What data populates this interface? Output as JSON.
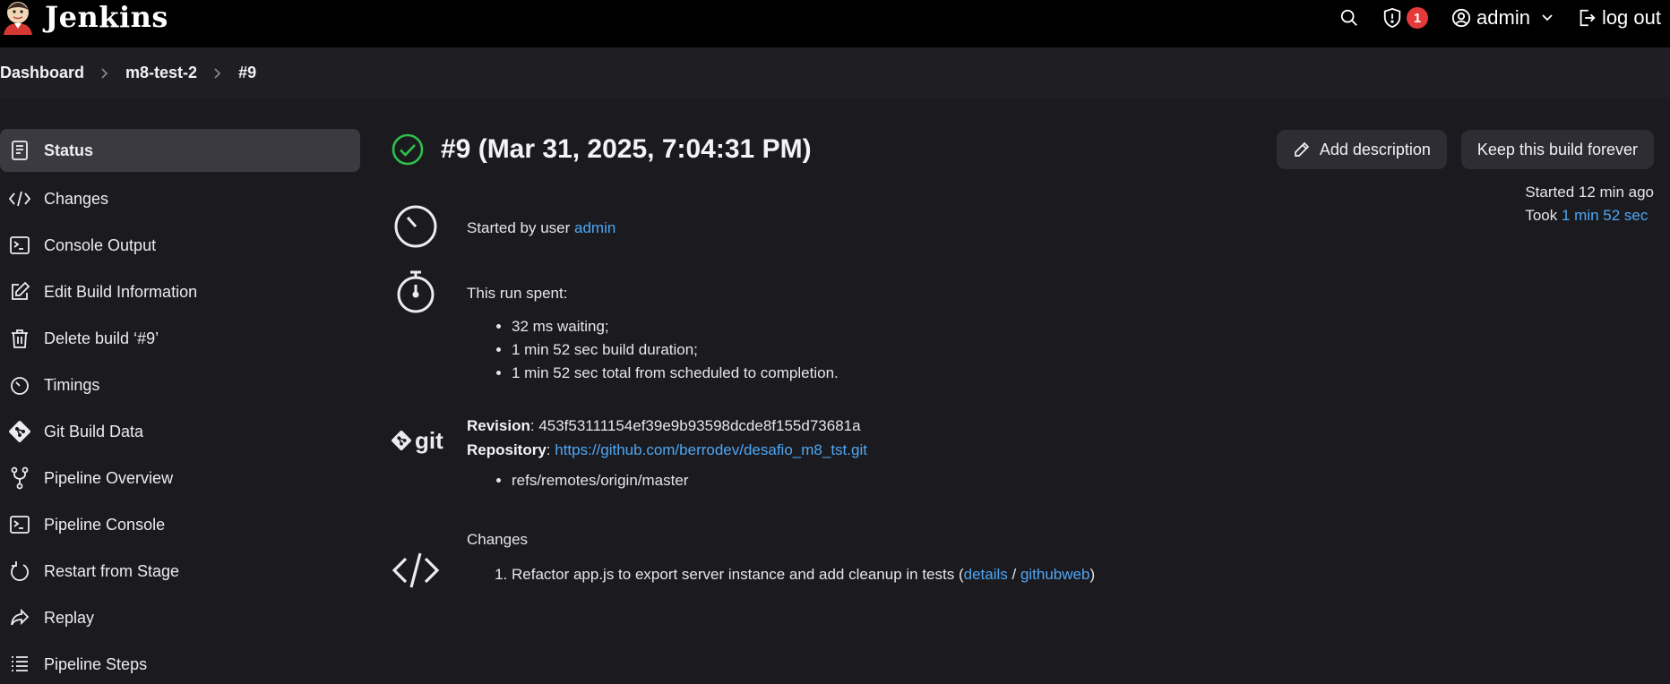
{
  "header": {
    "app_name": "Jenkins",
    "notification_count": "1",
    "user_label": "admin",
    "logout_label": "log out"
  },
  "breadcrumb": [
    "Dashboard",
    "m8-test-2",
    "#9"
  ],
  "sidebar": {
    "items": [
      {
        "label": "Status",
        "icon": "document-icon"
      },
      {
        "label": "Changes",
        "icon": "code-icon"
      },
      {
        "label": "Console Output",
        "icon": "terminal-icon"
      },
      {
        "label": "Edit Build Information",
        "icon": "edit-icon"
      },
      {
        "label": "Delete build ‘#9’",
        "icon": "trash-icon"
      },
      {
        "label": "Timings",
        "icon": "stopwatch-icon"
      },
      {
        "label": "Git Build Data",
        "icon": "git-icon"
      },
      {
        "label": "Pipeline Overview",
        "icon": "branch-icon"
      },
      {
        "label": "Pipeline Console",
        "icon": "terminal-icon"
      },
      {
        "label": "Restart from Stage",
        "icon": "restart-icon"
      },
      {
        "label": "Replay",
        "icon": "replay-icon"
      },
      {
        "label": "Pipeline Steps",
        "icon": "list-icon"
      }
    ]
  },
  "build": {
    "title": "#9 (Mar 31, 2025, 7:04:31 PM)",
    "add_description_label": "Add description",
    "keep_forever_label": "Keep this build forever",
    "started_by_prefix": "Started by user ",
    "started_by_user": "admin",
    "started_ago": "Started 12 min ago",
    "took_prefix": "Took ",
    "took_value": "1 min 52 sec",
    "run_spent_label": "This run spent:",
    "run_spent_items": [
      "32 ms waiting;",
      "1 min 52 sec build duration;",
      "1 min 52 sec total from scheduled to completion."
    ],
    "revision_label": "Revision",
    "revision_value": "453f53111154ef39e9b93598dcde8f155d73681a",
    "repository_label": "Repository",
    "repository_url": "https://github.com/berrodev/desafio_m8_tst.git",
    "refs": [
      "refs/remotes/origin/master"
    ],
    "git_logo_text": "git",
    "changes_label": "Changes",
    "changes": [
      {
        "text": "Refactor app.js to export server instance and add cleanup in tests (",
        "details_label": "details",
        "sep": " / ",
        "githubweb_label": "githubweb",
        "close": ")"
      }
    ]
  },
  "colors": {
    "success": "#2fbf4d",
    "link": "#4ea6f5",
    "badge": "#e5393b"
  }
}
